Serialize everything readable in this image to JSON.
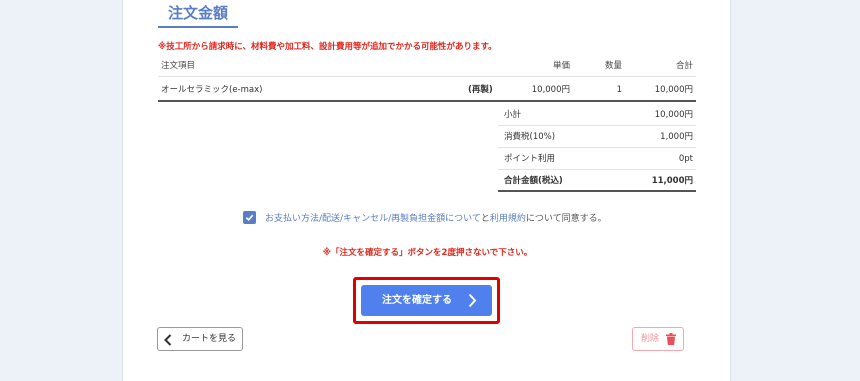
{
  "section": {
    "title": "注文金額"
  },
  "notice": "※技工所から請求時に、材料費や加工料、設計費用等が追加でかかる可能性があります。",
  "table": {
    "headers": {
      "item": "注文項目",
      "price": "単価",
      "qty": "数量",
      "total": "合計"
    },
    "rows": [
      {
        "name": "オールセラミック(e-max)",
        "tag": "(再製)",
        "price": "10,000円",
        "qty": "1",
        "total": "10,000円"
      }
    ]
  },
  "summary": [
    {
      "label": "小計",
      "value": "10,000円"
    },
    {
      "label": "消費税(10%)",
      "value": "1,000円"
    },
    {
      "label": "ポイント利用",
      "value": "0pt"
    },
    {
      "label": "合計金額(税込)",
      "value": "11,000円"
    }
  ],
  "agreement": {
    "checked": true,
    "link1": "お支払い方法/配送/キャンセル/再製負担金額について",
    "mid": "と",
    "link2": "利用規約",
    "suffix": "について同意する。"
  },
  "warning": "※「注文を確定する」ボタンを2度押さないで下さい。",
  "buttons": {
    "confirm": "注文を確定する",
    "cart": "カートを見る",
    "delete": "削除"
  },
  "colors": {
    "accent": "#5a7ec5",
    "confirm": "#4f80ee",
    "warning": "#e0281e",
    "highlight": "#e00000"
  }
}
